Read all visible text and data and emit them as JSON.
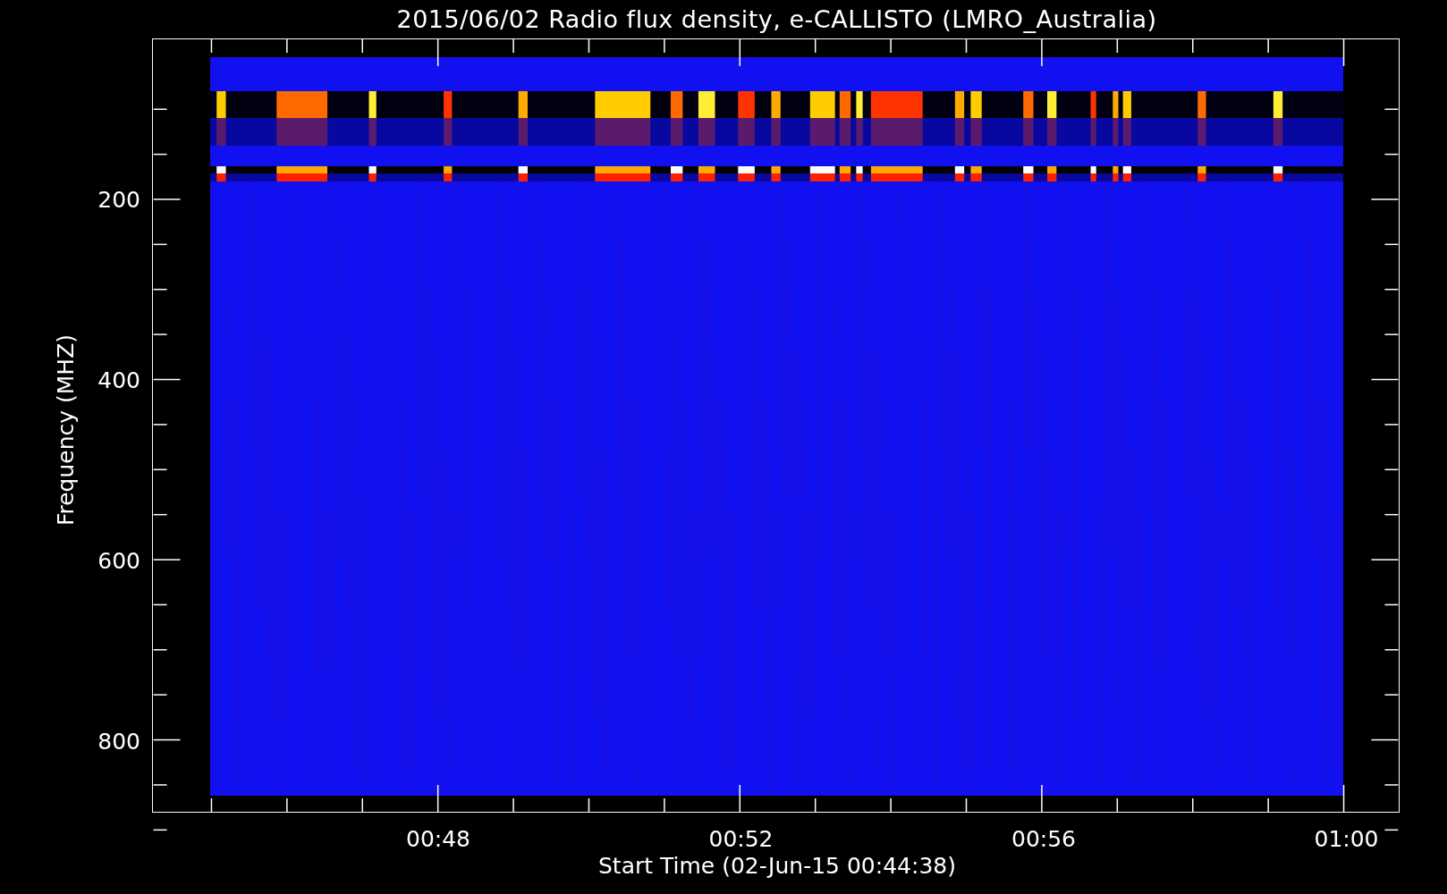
{
  "title": "2015/06/02  Radio flux density, e-CALLISTO (LMRO_Australia)",
  "y_axis": {
    "label": "Frequency (MHZ)",
    "ticks": [
      "200",
      "400",
      "600",
      "800"
    ]
  },
  "x_axis": {
    "label": "Start Time (02-Jun-15 00:44:38)",
    "ticks": [
      "00:48",
      "00:52",
      "00:56",
      "01:00"
    ]
  }
}
